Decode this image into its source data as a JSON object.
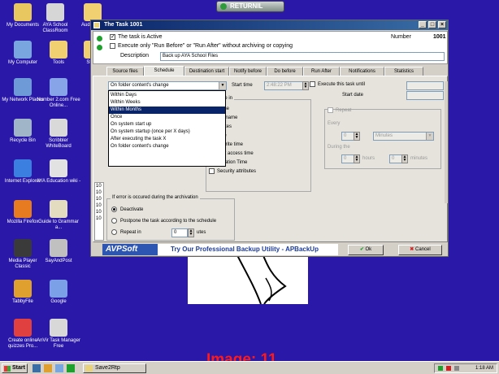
{
  "desktop": {
    "icons": [
      {
        "label": "My Documents",
        "icon": "folder-documents-icon",
        "color": "#e8c760"
      },
      {
        "label": "AYA School ClassRoom",
        "icon": "school-icon",
        "color": "#d6d6d6"
      },
      {
        "label": "Audio & Vi",
        "icon": "folder-icon",
        "color": "#f0d070"
      },
      {
        "label": "My Computer",
        "icon": "computer-icon",
        "color": "#7aa6e0"
      },
      {
        "label": "Tools",
        "icon": "folder-icon",
        "color": "#f0d070"
      },
      {
        "label": "Study",
        "icon": "folder-icon",
        "color": "#f0d070"
      },
      {
        "label": "My Network Places",
        "icon": "network-icon",
        "color": "#6f9ad8"
      },
      {
        "label": "Number 2.com Free Online...",
        "icon": "web-shortcut-icon",
        "color": "#88a4e8"
      },
      {
        "label": "Recycle Bin",
        "icon": "recycle-bin-icon",
        "color": "#a0b6c8"
      },
      {
        "label": "Scribbler WhiteBoard",
        "icon": "whiteboard-icon",
        "color": "#d9d9d9"
      },
      {
        "label": "Internet Explorer",
        "icon": "internet-explorer-icon",
        "color": "#3b7fe0"
      },
      {
        "label": "AYA Education wiki -",
        "icon": "book-icon",
        "color": "#e2e2e2"
      },
      {
        "label": "Mozilla Firefox",
        "icon": "firefox-icon",
        "color": "#e77b22"
      },
      {
        "label": "Guide to Grammar a...",
        "icon": "book-icon",
        "color": "#e4dcc0"
      },
      {
        "label": "Media Player Classic",
        "icon": "media-player-icon",
        "color": "#3a3a3a"
      },
      {
        "label": "SayAndPost",
        "icon": "microphone-icon",
        "color": "#c0c0c0"
      },
      {
        "label": "TabbyFile",
        "icon": "cat-icon",
        "color": "#e0a030"
      },
      {
        "label": "Google",
        "icon": "google-icon",
        "color": "#7ca0e8"
      },
      {
        "label": "Create online quizzes Pro...",
        "icon": "quiz-icon",
        "color": "#e04040"
      },
      {
        "label": "AnVir Task Manager Free",
        "icon": "task-manager-icon",
        "color": "#d8d8d8"
      }
    ]
  },
  "returnil": {
    "label": "RETURNIL"
  },
  "window": {
    "title": "The Task 1001",
    "min": "_",
    "max": "□",
    "close": "×",
    "active_label": "The task is Active",
    "active_checked": "✓",
    "number_label": "Number",
    "number_value": "1001",
    "execute_only_label": "Execute only \"Run Before\" or \"Run After\" without archiving or copying",
    "description_label": "Description",
    "description_value": "Back up AYA School Files"
  },
  "tabs": [
    "Source files",
    "Schedule",
    "Destination start",
    "Notify before",
    "Do before",
    "Run After",
    "Notifications",
    "Statistics"
  ],
  "schedule": {
    "start_select_value": "On folder content's change",
    "start_time_label": "Start time",
    "start_time_value": "2:48:22 PM",
    "exec_until_label": "Execute this task until",
    "start_date_label": "Start date",
    "dropdown_options": [
      "Within Days",
      "Within Weeks",
      "Within Months",
      "Once",
      "On system start up",
      "On system startup (once per X days)",
      "After executing the task X",
      "On folder content's change"
    ],
    "dropdown_selected_index": 2,
    "change_in_title": "change in",
    "change_items": [
      {
        "label": "name",
        "checked": false,
        "enabled": true
      },
      {
        "label": "der name",
        "checked": false,
        "enabled": true
      },
      {
        "label": "ributes",
        "checked": false,
        "enabled": true
      },
      {
        "label": "Size",
        "checked": false,
        "enabled": true
      },
      {
        "label": "st write time",
        "checked": false,
        "enabled": true
      },
      {
        "label": "Last access time",
        "checked": false,
        "enabled": true
      },
      {
        "label": "Creation Time",
        "checked": true,
        "enabled": true
      },
      {
        "label": "Security attributes",
        "checked": false,
        "enabled": true
      }
    ],
    "repeat": {
      "label": "Repeat",
      "every_label": "Every",
      "every_value": "0",
      "every_unit": "Minutes",
      "during_label": "During the",
      "hours_value": "0",
      "hours_label": "hours",
      "minutes_value": "0",
      "minutes_label": "minutes"
    },
    "error_group": {
      "title": "If error is occured during the archivation",
      "options": [
        {
          "label": "Deactivate",
          "selected": true
        },
        {
          "label": "Postpone the task according to the schedule",
          "selected": false
        },
        {
          "label": "Repeat in",
          "selected": false
        }
      ],
      "repeat_value": "0",
      "repeat_unit": "utes"
    },
    "left_list": [
      "10",
      "10",
      "10",
      "10",
      "10",
      "10"
    ]
  },
  "footer": {
    "brand": "AVPSoft",
    "banner_text": "Try Our Professional Backup Utility - APBackUp",
    "ok_label": "Ok",
    "cancel_label": "Cancel"
  },
  "taskbar": {
    "start_label": "Start",
    "task_label": "Save2Rtp",
    "clock": "1:18 AM"
  },
  "overlay_label": "Image: 11",
  "colors": {
    "desktop": "#2a18a8",
    "title_bar": "#0a246a",
    "selected": "#0a246a",
    "overlay": "#ff1a1a"
  }
}
